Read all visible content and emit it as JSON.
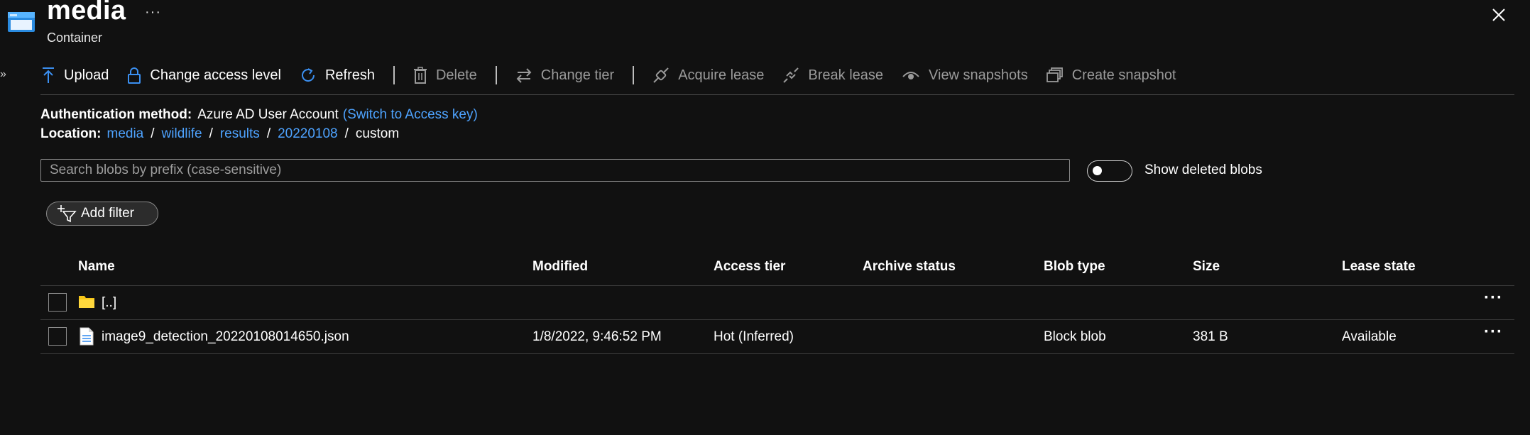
{
  "header": {
    "title": "media",
    "subtitle": "Container",
    "more_label": "···",
    "close_label": "Close",
    "sidebar_toggle": "»"
  },
  "toolbar": {
    "items": [
      {
        "label": "Upload",
        "icon": "upload-icon",
        "enabled": true
      },
      {
        "label": "Change access level",
        "icon": "lock-icon",
        "enabled": true
      },
      {
        "label": "Refresh",
        "icon": "refresh-icon",
        "enabled": true
      },
      {
        "label": "Delete",
        "icon": "trash-icon",
        "enabled": false
      },
      {
        "label": "Change tier",
        "icon": "swap-icon",
        "enabled": false
      },
      {
        "label": "Acquire lease",
        "icon": "link-icon",
        "enabled": false
      },
      {
        "label": "Break lease",
        "icon": "broken-link-icon",
        "enabled": false
      },
      {
        "label": "View snapshots",
        "icon": "eye-icon",
        "enabled": false
      },
      {
        "label": "Create snapshot",
        "icon": "snapshot-icon",
        "enabled": false
      }
    ]
  },
  "auth": {
    "label": "Authentication method:",
    "value": "Azure AD User Account",
    "switch_link": "(Switch to Access key)"
  },
  "location": {
    "label": "Location:",
    "crumbs": [
      "media",
      "wildlife",
      "results",
      "20220108"
    ],
    "separator": "/",
    "current": "custom"
  },
  "search": {
    "placeholder": "Search blobs by prefix (case-sensitive)",
    "value": ""
  },
  "show_deleted": {
    "label": "Show deleted blobs",
    "on": false
  },
  "filter": {
    "label": "Add filter"
  },
  "table": {
    "columns": [
      "Name",
      "Modified",
      "Access tier",
      "Archive status",
      "Blob type",
      "Size",
      "Lease state"
    ],
    "rows": [
      {
        "icon": "folder-icon",
        "name": "[..]",
        "modified": "",
        "access_tier": "",
        "archive_status": "",
        "blob_type": "",
        "size": "",
        "lease_state": "",
        "more": "···"
      },
      {
        "icon": "file-icon",
        "name": "image9_detection_20220108014650.json",
        "modified": "1/8/2022, 9:46:52 PM",
        "access_tier": "Hot (Inferred)",
        "archive_status": "",
        "blob_type": "Block blob",
        "size": "381 B",
        "lease_state": "Available",
        "more": "···"
      }
    ]
  },
  "colors": {
    "background": "#111111",
    "link": "#4ea3ff",
    "accent_icon": "#3b8ff0",
    "folder": "#f5c518",
    "disabled_text": "#9a9a9a"
  }
}
